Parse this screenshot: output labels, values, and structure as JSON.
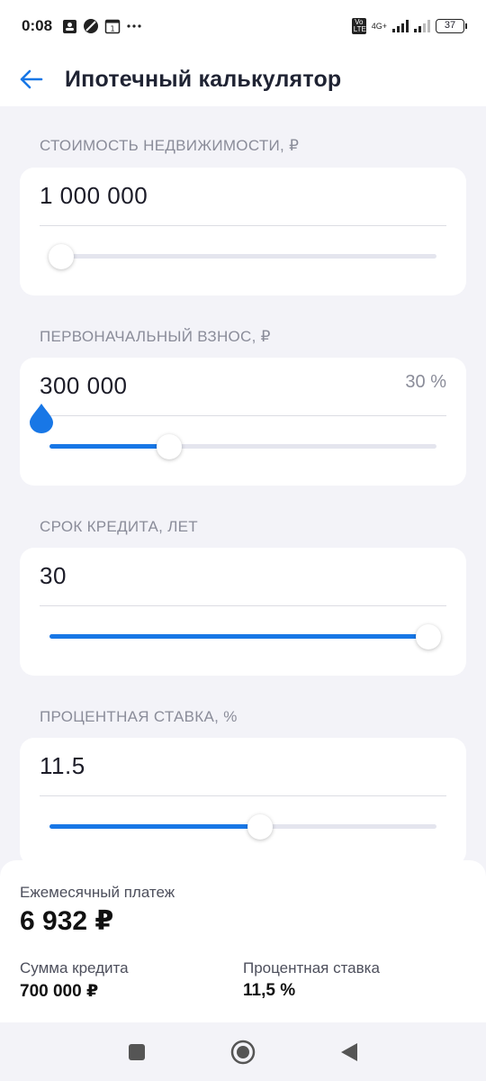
{
  "status_bar": {
    "time": "0:08",
    "volte": "Vo LTE",
    "network": "4G+",
    "battery": "37"
  },
  "header": {
    "back_icon": "arrow-left-icon",
    "title": "Ипотечный калькулятор"
  },
  "fields": {
    "price": {
      "label": "СТОИМОСТЬ НЕДВИЖИМОСТИ, ₽",
      "value": "1 000 000",
      "slider_fraction": 0.03
    },
    "down_payment": {
      "label": "ПЕРВОНАЧАЛЬНЫЙ ВЗНОС, ₽",
      "value": "300 000",
      "percent": "30 %",
      "slider_fraction": 0.31
    },
    "term": {
      "label": "СРОК КРЕДИТА, ЛЕТ",
      "value": "30",
      "slider_fraction": 0.98
    },
    "rate": {
      "label": "ПРОЦЕНТНАЯ СТАВКА, %",
      "value": "11.5",
      "slider_fraction": 0.545
    }
  },
  "summary": {
    "monthly_label": "Ежемесячный платеж",
    "monthly_value": "6 932 ₽",
    "loan_label": "Сумма кредита",
    "loan_value": "700 000 ₽",
    "rate_label": "Процентная ставка",
    "rate_value": "11,5 %"
  },
  "colors": {
    "accent": "#1877e6",
    "background": "#f3f3f8",
    "muted_text": "#8a8c99"
  },
  "nav_bar": [
    "square-icon",
    "home-circle-icon",
    "back-triangle-icon"
  ]
}
